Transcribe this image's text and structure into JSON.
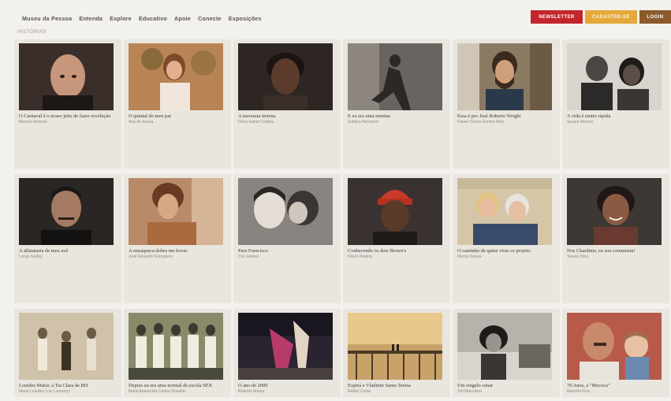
{
  "nav": {
    "items": [
      "Museu da Pessoa",
      "Entenda",
      "Explore",
      "Educativo",
      "Apoie",
      "Conecte",
      "Exposições"
    ]
  },
  "actions": {
    "newsletter": "NEWSLETTER",
    "cadastre": "CADASTRE-SE",
    "login": "LOGIN"
  },
  "section": {
    "label": "HISTÓRIAS"
  },
  "stories": [
    {
      "title": "O Carnaval é o nosso jeito de fazer revolução",
      "author": "Marcelo Antonio",
      "photo": "bald-man-portrait"
    },
    {
      "title": "O quintal do meu pai",
      "author": "Ana de Souza",
      "photo": "woman-garden"
    },
    {
      "title": "A travessia terrena",
      "author": "Dona Isabel Cristina",
      "photo": "older-woman-portrait"
    },
    {
      "title": "E eu era uma menina",
      "author": "Zulmira Hermann",
      "photo": "woman-window-bw"
    },
    {
      "title": "Essa é pro José Roberto Wright",
      "author": "Daniel Carlos Gomes Neto",
      "photo": "bearded-man-library"
    },
    {
      "title": "A vida é muito rápida",
      "author": "Suzani Moreno",
      "photo": "couple-bw"
    },
    {
      "title": "A alfaiataria de meu avô",
      "author": "Lucas Godoy",
      "photo": "mustache-man"
    },
    {
      "title": "A enxaqueca dobra me levou",
      "author": "José Eduardo Gonçalves",
      "photo": "curly-hair-man"
    },
    {
      "title": "Para Francisco",
      "author": "Ciro Gomes",
      "photo": "kids-kiss-bw"
    },
    {
      "title": "Conhecendo os dois Brown's",
      "author": "Flávio Pereira",
      "photo": "red-beanie-man"
    },
    {
      "title": "O caminho de quinz viras os projeto",
      "author": "Marcia Souza",
      "photo": "two-women"
    },
    {
      "title": "Nos Chardinis, eu sou comunista!",
      "author": "Tereza Silva",
      "photo": "smiling-woman"
    },
    {
      "title": "Lourdes Maria: a Tia Clara de BH",
      "author": "Maria Lourdes Luiz Lourenço",
      "photo": "group-sepia"
    },
    {
      "title": "Depois eu era uma normal de escola SEX",
      "author": "Maria Aparecida Carlos Oswaldo",
      "photo": "women-group"
    },
    {
      "title": "O ano de 2009",
      "author": "Roberto Araújo",
      "photo": "dancers-street"
    },
    {
      "title": "Expirá e Vladimir Santa Teresa",
      "author": "Rafael Costa",
      "photo": "bridge-sunset"
    },
    {
      "title": "Um singelo sonar",
      "author": "Toti Marculina",
      "photo": "woman-car-bw"
    },
    {
      "title": "70 Anos, a \"Mococa\"",
      "author": "Marcelo Fina",
      "photo": "man-and-baby"
    }
  ]
}
